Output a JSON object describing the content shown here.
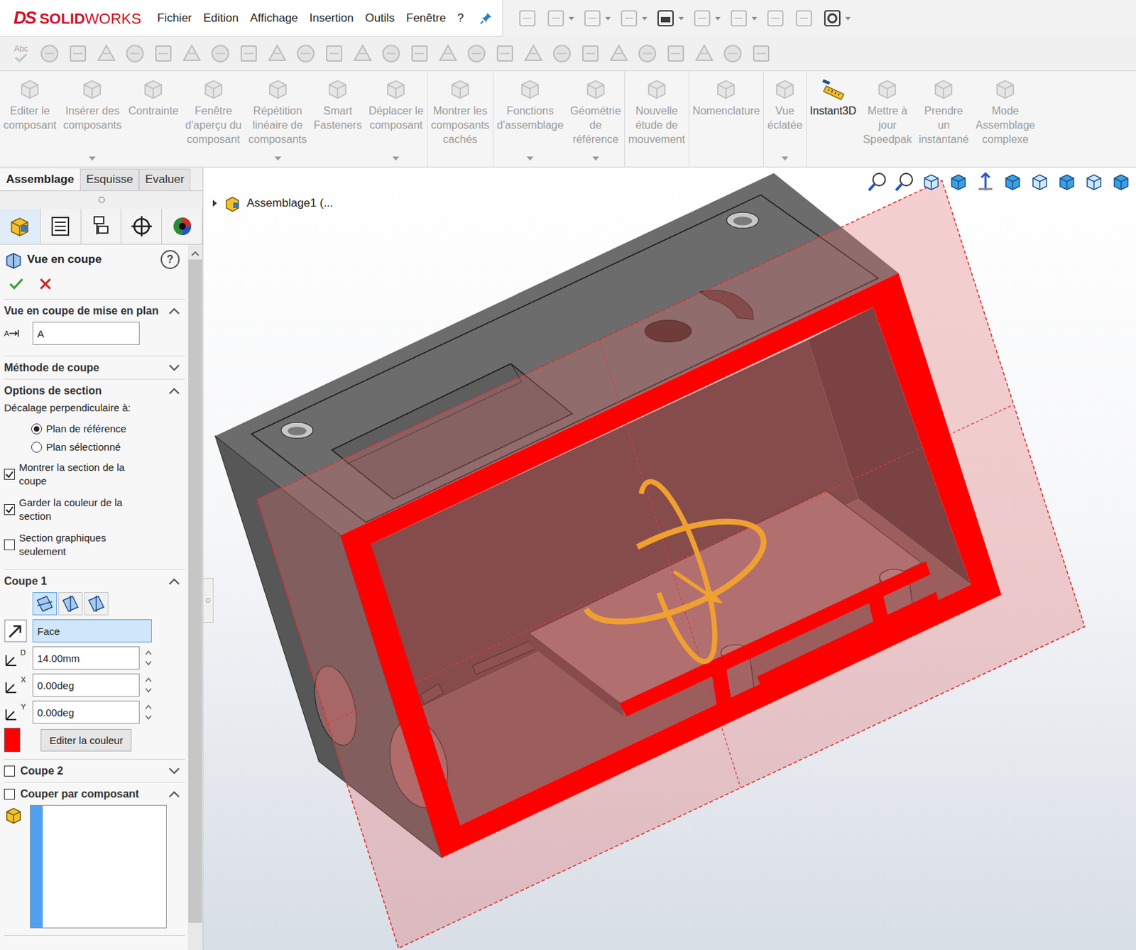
{
  "logo": {
    "mark": "DS",
    "name_bold": "SOLID",
    "name_light": "WORKS"
  },
  "menu": [
    "Fichier",
    "Edition",
    "Affichage",
    "Insertion",
    "Outils",
    "Fenêtre",
    "?"
  ],
  "quick_access": [
    {
      "dropdown": false,
      "disabled": true
    },
    {
      "dropdown": true,
      "disabled": true
    },
    {
      "dropdown": true,
      "disabled": true
    },
    {
      "dropdown": true,
      "disabled": true
    },
    {
      "dropdown": true,
      "disabled": false
    },
    {
      "dropdown": true,
      "disabled": true
    },
    {
      "dropdown": true,
      "disabled": true
    },
    {
      "dropdown": false,
      "disabled": true
    },
    {
      "dropdown": false,
      "disabled": true
    },
    {
      "dropdown": true,
      "disabled": false
    }
  ],
  "toolbar2": {
    "first_label": "Abc"
  },
  "ribbon": [
    {
      "lines": [
        "Editer le",
        "composant"
      ],
      "disabled": true,
      "dropdown": false,
      "separator_after": false
    },
    {
      "lines": [
        "Insérer des",
        "composants"
      ],
      "disabled": true,
      "dropdown": true,
      "separator_after": false
    },
    {
      "lines": [
        "Contrainte"
      ],
      "disabled": true,
      "dropdown": false,
      "separator_after": false
    },
    {
      "lines": [
        "Fenêtre",
        "d'aperçu du",
        "composant"
      ],
      "disabled": true,
      "dropdown": false,
      "separator_after": false
    },
    {
      "lines": [
        "Répétition",
        "linéaire de",
        "composants"
      ],
      "disabled": true,
      "dropdown": true,
      "separator_after": false
    },
    {
      "lines": [
        "Smart",
        "Fasteners"
      ],
      "disabled": true,
      "dropdown": false,
      "separator_after": false
    },
    {
      "lines": [
        "Déplacer le",
        "composant"
      ],
      "disabled": true,
      "dropdown": true,
      "separator_after": true
    },
    {
      "lines": [
        "Montrer les",
        "composants",
        "cachés"
      ],
      "disabled": true,
      "dropdown": false,
      "separator_after": true
    },
    {
      "lines": [
        "Fonctions",
        "d'assemblage"
      ],
      "disabled": true,
      "dropdown": true,
      "separator_after": false
    },
    {
      "lines": [
        "Géométrie",
        "de",
        "référence"
      ],
      "disabled": true,
      "dropdown": true,
      "separator_after": true
    },
    {
      "lines": [
        "Nouvelle",
        "étude de",
        "mouvement"
      ],
      "disabled": true,
      "dropdown": false,
      "separator_after": true
    },
    {
      "lines": [
        "Nomenclature"
      ],
      "disabled": true,
      "dropdown": false,
      "separator_after": true
    },
    {
      "lines": [
        "Vue",
        "éclatée"
      ],
      "disabled": true,
      "dropdown": true,
      "separator_after": true
    },
    {
      "lines": [
        "Instant3D"
      ],
      "disabled": false,
      "dropdown": false,
      "separator_after": false
    },
    {
      "lines": [
        "Mettre à",
        "jour",
        "Speedpak"
      ],
      "disabled": true,
      "dropdown": false,
      "separator_after": false
    },
    {
      "lines": [
        "Prendre",
        "un",
        "instantané"
      ],
      "disabled": true,
      "dropdown": false,
      "separator_after": false
    },
    {
      "lines": [
        "Mode",
        "Assemblage",
        "complexe"
      ],
      "disabled": true,
      "dropdown": false,
      "separator_after": false
    }
  ],
  "tabs": [
    {
      "label": "Assemblage",
      "selected": true
    },
    {
      "label": "Esquisse",
      "selected": false
    },
    {
      "label": "Evaluer",
      "selected": false
    }
  ],
  "panel_tabs": [
    {
      "selected": true
    },
    {
      "selected": false
    },
    {
      "selected": false
    },
    {
      "selected": false
    },
    {
      "selected": false
    }
  ],
  "property_manager": {
    "title": "Vue en coupe",
    "help": "?",
    "sections": [
      {
        "kind": "field",
        "title": "Vue en coupe de mise en plan",
        "expanded": true,
        "icon_letter": "A",
        "value": "A"
      },
      {
        "kind": "header",
        "title": "Méthode de coupe",
        "expanded": false
      },
      {
        "kind": "options",
        "title": "Options de section",
        "expanded": true,
        "caption": "Décalage perpendiculaire à:",
        "radios": [
          {
            "label": "Plan de référence",
            "selected": true
          },
          {
            "label": "Plan sélectionné",
            "selected": false
          }
        ],
        "checks": [
          {
            "label": "Montrer la section de la coupe",
            "checked": true
          },
          {
            "label": "Garder la couleur de la section",
            "checked": true
          },
          {
            "label": "Section graphiques seulement",
            "checked": false
          }
        ]
      },
      {
        "kind": "cut",
        "title": "Coupe 1",
        "expanded": true,
        "planes": [
          {
            "selected": true
          },
          {
            "selected": false
          },
          {
            "selected": false
          }
        ],
        "face": "Face",
        "face_active": true,
        "inputs": [
          {
            "icon_letter": "D",
            "value": "14.00mm"
          },
          {
            "icon_letter": "X",
            "value": "0.00deg"
          },
          {
            "icon_letter": "Y",
            "value": "0.00deg"
          }
        ],
        "section_color": "#ff0000",
        "color_button": "Editer la couleur"
      },
      {
        "kind": "check_header",
        "title": "Coupe 2",
        "checked": false,
        "expanded": false
      },
      {
        "kind": "check_list",
        "title": "Couper par composant",
        "checked": false,
        "expanded": true
      }
    ]
  },
  "viewport": {
    "tree_root": "Assemblage1 (..."
  }
}
